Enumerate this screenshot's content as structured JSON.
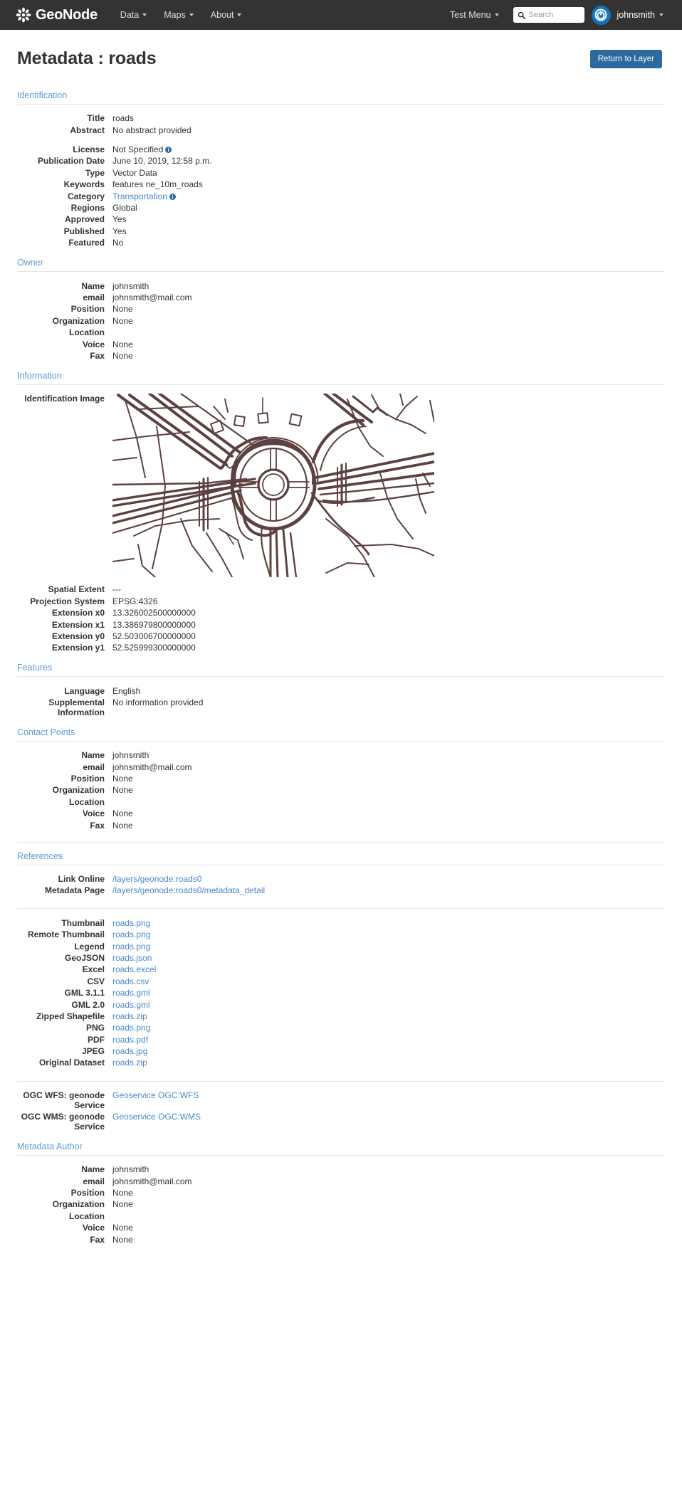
{
  "navbar": {
    "brand": "GeoNode",
    "menu": [
      {
        "label": "Data"
      },
      {
        "label": "Maps"
      },
      {
        "label": "About"
      }
    ],
    "test_menu": "Test Menu",
    "search_placeholder": "Search",
    "search_value": "",
    "username": "johnsmith"
  },
  "page": {
    "title": "Metadata : roads",
    "return_button": "Return to Layer"
  },
  "sections": {
    "identification": {
      "title": "Identification",
      "rows_top": [
        {
          "label": "Title",
          "value": "roads"
        },
        {
          "label": "Abstract",
          "value": "No abstract provided"
        }
      ],
      "rows_bottom": [
        {
          "label": "License",
          "value": "Not Specified",
          "info": true
        },
        {
          "label": "Publication Date",
          "value": "June 10, 2019, 12:58 p.m."
        },
        {
          "label": "Type",
          "value": "Vector Data"
        },
        {
          "label": "Keywords",
          "value": "features ne_10m_roads"
        },
        {
          "label": "Category",
          "value": "Transportation",
          "link": true,
          "info": true
        },
        {
          "label": "Regions",
          "value": "Global"
        },
        {
          "label": "Approved",
          "value": "Yes"
        },
        {
          "label": "Published",
          "value": "Yes"
        },
        {
          "label": "Featured",
          "value": "No"
        }
      ]
    },
    "owner": {
      "title": "Owner",
      "rows": [
        {
          "label": "Name",
          "value": "johnsmith"
        },
        {
          "label": "email",
          "value": "johnsmith@mail.com"
        },
        {
          "label": "Position",
          "value": "None"
        },
        {
          "label": "Organization",
          "value": "None"
        },
        {
          "label": "Location",
          "value": ""
        },
        {
          "label": "Voice",
          "value": "None"
        },
        {
          "label": "Fax",
          "value": "None"
        }
      ]
    },
    "information": {
      "title": "Information",
      "image_label": "Identification Image",
      "image_alt": "roads layer thumbnail showing a roundabout road network",
      "rows": [
        {
          "label": "Spatial Extent",
          "value": "---"
        },
        {
          "label": "Projection System",
          "value": "EPSG:4326"
        },
        {
          "label": "Extension x0",
          "value": "13.326002500000000"
        },
        {
          "label": "Extension x1",
          "value": "13.386979800000000"
        },
        {
          "label": "Extension y0",
          "value": "52.503006700000000"
        },
        {
          "label": "Extension y1",
          "value": "52.525999300000000"
        }
      ]
    },
    "features": {
      "title": "Features",
      "rows": [
        {
          "label": "Language",
          "value": "English"
        },
        {
          "label": "Supplemental Information",
          "value": "No information provided"
        }
      ]
    },
    "contact_points": {
      "title": "Contact Points",
      "rows": [
        {
          "label": "Name",
          "value": "johnsmith"
        },
        {
          "label": "email",
          "value": "johnsmith@mail.com"
        },
        {
          "label": "Position",
          "value": "None"
        },
        {
          "label": "Organization",
          "value": "None"
        },
        {
          "label": "Location",
          "value": ""
        },
        {
          "label": "Voice",
          "value": "None"
        },
        {
          "label": "Fax",
          "value": "None"
        }
      ]
    },
    "references": {
      "title": "References",
      "pages": [
        {
          "label": "Link Online",
          "value": "/layers/geonode:roads0",
          "link": true
        },
        {
          "label": "Metadata Page",
          "value": "/layers/geonode:roads0/metadata_detail",
          "link": true
        }
      ],
      "downloads": [
        {
          "label": "Thumbnail",
          "value": "roads.png",
          "link": true
        },
        {
          "label": "Remote Thumbnail",
          "value": "roads.png",
          "link": true
        },
        {
          "label": "Legend",
          "value": "roads.png",
          "link": true
        },
        {
          "label": "GeoJSON",
          "value": "roads.json",
          "link": true
        },
        {
          "label": "Excel",
          "value": "roads.excel",
          "link": true
        },
        {
          "label": "CSV",
          "value": "roads.csv",
          "link": true
        },
        {
          "label": "GML 3.1.1",
          "value": "roads.gml",
          "link": true
        },
        {
          "label": "GML 2.0",
          "value": "roads.gml",
          "link": true
        },
        {
          "label": "Zipped Shapefile",
          "value": "roads.zip",
          "link": true
        },
        {
          "label": "PNG",
          "value": "roads.png",
          "link": true
        },
        {
          "label": "PDF",
          "value": "roads.pdf",
          "link": true
        },
        {
          "label": "JPEG",
          "value": "roads.jpg",
          "link": true
        },
        {
          "label": "Original Dataset",
          "value": "roads.zip",
          "link": true
        }
      ],
      "services": [
        {
          "label": "OGC WFS: geonode Service",
          "value": "Geoservice OGC:WFS",
          "link": true
        },
        {
          "label": "OGC WMS: geonode Service",
          "value": "Geoservice OGC:WMS",
          "link": true
        }
      ]
    },
    "metadata_author": {
      "title": "Metadata Author",
      "rows": [
        {
          "label": "Name",
          "value": "johnsmith"
        },
        {
          "label": "email",
          "value": "johnsmith@mail.com"
        },
        {
          "label": "Position",
          "value": "None"
        },
        {
          "label": "Organization",
          "value": "None"
        },
        {
          "label": "Location",
          "value": ""
        },
        {
          "label": "Voice",
          "value": "None"
        },
        {
          "label": "Fax",
          "value": "None"
        }
      ]
    }
  },
  "colors": {
    "navbar_bg": "#333333",
    "section_heading": "#5b9bd5",
    "link": "#4a87c4",
    "button_primary": "#2c6a9e",
    "avatar_bg": "#1275bc",
    "map_stroke": "#5c4140"
  }
}
